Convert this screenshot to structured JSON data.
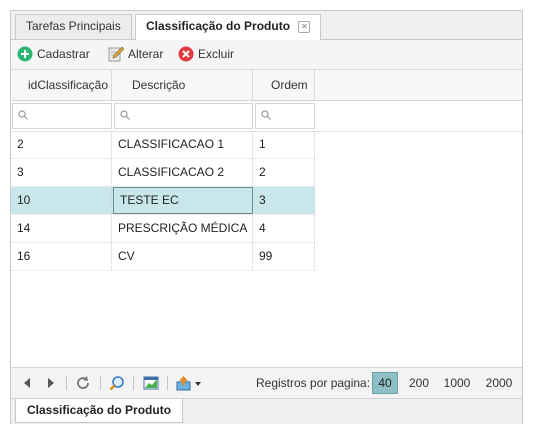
{
  "tabs": [
    {
      "label": "Tarefas Principais"
    },
    {
      "label": "Classificação do Produto"
    }
  ],
  "toolbar": {
    "cadastrar": "Cadastrar",
    "alterar": "Alterar",
    "excluir": "Excluir"
  },
  "columns": [
    "idClassificação",
    "Descrição",
    "Ordem"
  ],
  "rows": [
    {
      "id": "2",
      "descricao": "CLASSIFICACAO 1",
      "ordem": "1"
    },
    {
      "id": "3",
      "descricao": "CLASSIFICACAO 2",
      "ordem": "2"
    },
    {
      "id": "10",
      "descricao": "TESTE EC",
      "ordem": "3"
    },
    {
      "id": "14",
      "descricao": "PRESCRIÇÃO MÉDICA",
      "ordem": "4"
    },
    {
      "id": "16",
      "descricao": "CV",
      "ordem": "99"
    }
  ],
  "selected_row_id": "10",
  "pager": {
    "label": "Registros por pagina:",
    "sizes": [
      "40",
      "200",
      "1000",
      "2000"
    ],
    "active_size": "40"
  },
  "bottom_tab": "Classificação do Produto",
  "colors": {
    "selected_row": "#c9e6ea",
    "active_page_size": "#8fc0c6",
    "add_icon": "#2bb673",
    "delete_icon": "#e5393f"
  },
  "icons": [
    "add-icon",
    "edit-icon",
    "delete-icon",
    "search-icon",
    "first-page-icon",
    "next-page-icon",
    "refresh-icon",
    "zoom-icon",
    "chart-icon",
    "export-icon"
  ]
}
